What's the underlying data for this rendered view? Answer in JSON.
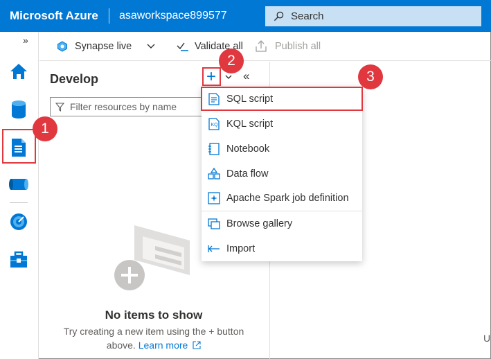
{
  "header": {
    "brand": "Microsoft Azure",
    "workspace": "asaworkspace899577",
    "search_placeholder": "Search"
  },
  "rail": {
    "collapse_glyph": "»",
    "items": [
      {
        "icon": "home-icon"
      },
      {
        "icon": "data-icon"
      },
      {
        "icon": "develop-icon"
      },
      {
        "icon": "integrate-icon"
      },
      {
        "icon": "monitor-icon"
      },
      {
        "icon": "manage-icon"
      }
    ]
  },
  "toolbar": {
    "mode_label": "Synapse live",
    "validate_label": "Validate all",
    "publish_label": "Publish all"
  },
  "develop": {
    "title": "Develop",
    "add_glyph": "+",
    "collapse_glyph": "«",
    "filter_placeholder": "Filter resources by name",
    "empty_title": "No items to show",
    "empty_text": "Try creating a new item using the + button above.",
    "learn_more": "Learn more"
  },
  "menu": {
    "items": [
      {
        "label": "SQL script",
        "icon": "sql-script-icon"
      },
      {
        "label": "KQL script",
        "icon": "kql-script-icon"
      },
      {
        "label": "Notebook",
        "icon": "notebook-icon"
      },
      {
        "label": "Data flow",
        "icon": "data-flow-icon"
      },
      {
        "label": "Apache Spark job definition",
        "icon": "spark-job-icon"
      },
      {
        "label": "Browse gallery",
        "icon": "gallery-icon"
      },
      {
        "label": "Import",
        "icon": "import-icon"
      }
    ]
  },
  "callouts": {
    "one": "1",
    "two": "2",
    "three": "3"
  },
  "edge_text": "U",
  "colors": {
    "accent": "#0078d4",
    "callout": "#e0383e",
    "search_bg": "#c7e0f4"
  }
}
